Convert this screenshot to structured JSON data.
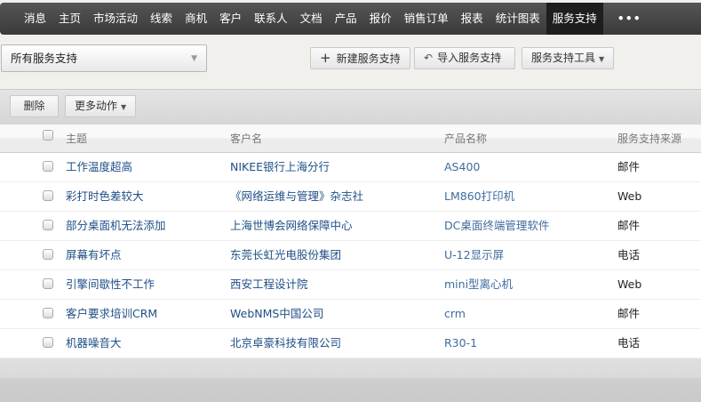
{
  "nav": {
    "items": [
      "消息",
      "主页",
      "市场活动",
      "线索",
      "商机",
      "客户",
      "联系人",
      "文档",
      "产品",
      "报价",
      "销售订单",
      "报表",
      "统计图表",
      "服务支持"
    ],
    "active": "服务支持",
    "more": "•••"
  },
  "view_select": {
    "value": "所有服务支持"
  },
  "actions": {
    "new": "新建服务支持",
    "import": "导入服务支持",
    "tools": "服务支持工具",
    "delete": "删除",
    "more_actions": "更多动作"
  },
  "table": {
    "headers": [
      "主题",
      "客户名",
      "产品名称",
      "服务支持来源"
    ],
    "rows": [
      [
        "工作温度超高",
        "NIKEE银行上海分行",
        "AS400",
        "邮件"
      ],
      [
        "彩打时色差较大",
        "《网络运维与管理》杂志社",
        "LM860打印机",
        "Web"
      ],
      [
        "部分桌面机无法添加",
        "上海世博会网络保障中心",
        "DC桌面终端管理软件",
        "邮件"
      ],
      [
        "屏幕有坏点",
        "东莞长虹光电股份集团",
        "U-12显示屏",
        "电话"
      ],
      [
        "引擎间歇性不工作",
        "西安工程设计院",
        "mini型离心机",
        "Web"
      ],
      [
        "客户要求培训CRM",
        "WebNMS中国公司",
        "crm",
        "邮件"
      ],
      [
        "机器噪音大",
        "北京卓豪科技有限公司",
        "R30-1",
        "电话"
      ]
    ]
  }
}
